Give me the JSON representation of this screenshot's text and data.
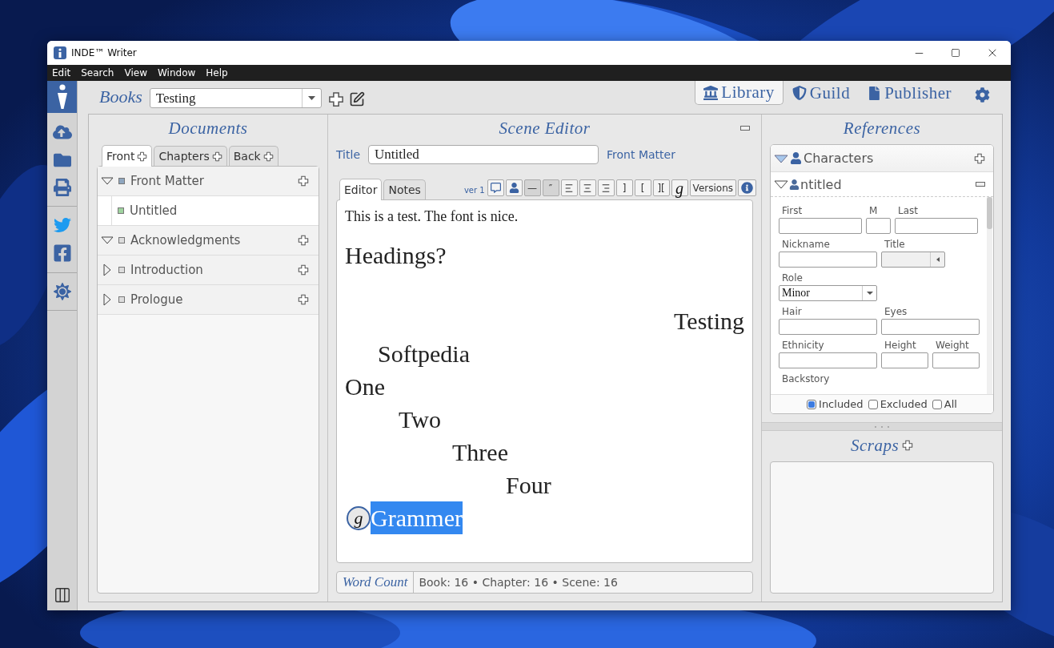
{
  "window": {
    "title": "INDE™ Writer"
  },
  "menu": [
    "Edit",
    "Search",
    "View",
    "Window",
    "Help"
  ],
  "rail": {
    "logo": {
      "selected": true
    },
    "groups": [
      [
        {
          "kind": "cloud"
        },
        {
          "kind": "download"
        },
        {
          "kind": "print"
        }
      ],
      [
        {
          "kind": "twitter"
        },
        {
          "kind": "facebook"
        }
      ],
      [
        {
          "kind": "sun"
        }
      ]
    ],
    "bottom": {
      "kind": "columns"
    }
  },
  "books": {
    "label": "Books",
    "value": "Testing"
  },
  "top_nav": [
    {
      "label": "Library",
      "kind": "library",
      "selected": true
    },
    {
      "label": "Guild",
      "kind": "guild",
      "selected": false
    },
    {
      "label": "Publisher",
      "kind": "publisher",
      "selected": false
    }
  ],
  "documents": {
    "title": "Documents",
    "tabs": [
      {
        "label": "Front",
        "selected": true
      },
      {
        "label": "Chapters",
        "selected": false
      },
      {
        "label": "Back",
        "selected": false
      }
    ],
    "tree": [
      {
        "label": "Front Matter",
        "expanded": true,
        "selected": false,
        "color": "#8fa6bf",
        "children": [
          {
            "label": "Untitled",
            "selected": true,
            "color": "#9fd39f"
          }
        ]
      },
      {
        "label": "Acknowledgments",
        "expanded": true,
        "selected": false,
        "color": "#dcdcdc"
      },
      {
        "label": "Introduction",
        "expanded": false,
        "selected": false,
        "color": "#dcdcdc"
      },
      {
        "label": "Prologue",
        "expanded": false,
        "selected": false,
        "color": "#dcdcdc"
      }
    ]
  },
  "scene_editor": {
    "title": "Scene Editor",
    "title_label": "Title",
    "title_value": "Untitled",
    "section": "Front Matter",
    "tabs": [
      {
        "label": "Editor",
        "selected": true
      },
      {
        "label": "Notes",
        "selected": false
      }
    ],
    "version": "ver 1",
    "toolbar": [
      {
        "kind": "comment",
        "pressed": false
      },
      {
        "kind": "person",
        "pressed": false
      },
      {
        "kind": "text",
        "label": "—",
        "pressed": true
      },
      {
        "kind": "text",
        "label": "″",
        "pressed": true
      },
      {
        "kind": "align-left",
        "pressed": false
      },
      {
        "kind": "align-center",
        "pressed": false
      },
      {
        "kind": "align-right",
        "pressed": false
      },
      {
        "kind": "text",
        "label": "]",
        "pressed": false
      },
      {
        "kind": "text",
        "label": "[",
        "pressed": false
      },
      {
        "kind": "text",
        "label": "][",
        "pressed": false
      },
      {
        "kind": "script",
        "label": "g",
        "pressed": false
      },
      {
        "kind": "text",
        "label": "Versions",
        "pressed": false
      },
      {
        "kind": "info",
        "pressed": false
      }
    ],
    "content": [
      {
        "kind": "body",
        "text": "This is a test. The font is nice."
      },
      {
        "kind": "heading",
        "text": "Headings?"
      },
      {
        "kind": "heading",
        "right_aligned": true,
        "gap_before": true,
        "text": "Testing"
      },
      {
        "kind": "heading",
        "indented": true,
        "text": "Softpedia"
      },
      {
        "kind": "heading",
        "text": "One"
      },
      {
        "kind": "heading",
        "text": "\tTwo"
      },
      {
        "kind": "heading",
        "text": "\t\tThree"
      },
      {
        "kind": "heading",
        "text": "\t\t\tFour"
      },
      {
        "kind": "heading",
        "text": "Grammer",
        "selected": true,
        "marker": "g"
      }
    ],
    "word_count": {
      "label": "Word Count",
      "value": "Book: 16 • Chapter: 16 • Scene: 16"
    }
  },
  "references": {
    "title": "References",
    "section": {
      "label": "Characters",
      "expanded": true
    },
    "character": {
      "name": "ntitled",
      "expanded": true
    },
    "form_rows": [
      [
        {
          "label": "First",
          "kind": "name"
        },
        {
          "label": "M",
          "kind": "initial"
        },
        {
          "label": "Last",
          "kind": "name"
        }
      ],
      [
        {
          "label": "Nickname",
          "kind": "text"
        },
        {
          "label": "Title",
          "kind": "spinner"
        }
      ],
      [
        {
          "label": "Role",
          "kind": "select",
          "value": "Minor"
        }
      ],
      [
        {
          "label": "Hair",
          "kind": "text"
        },
        {
          "label": "Eyes",
          "kind": "text"
        }
      ],
      [
        {
          "label": "Ethnicity",
          "kind": "text"
        },
        {
          "label": "Height",
          "kind": "measure"
        },
        {
          "label": "Weight",
          "kind": "measure"
        }
      ],
      [
        {
          "label": "Backstory",
          "kind": "heading"
        }
      ]
    ],
    "filters": [
      {
        "label": "Included",
        "checked": true
      },
      {
        "label": "Excluded",
        "checked": false
      },
      {
        "label": "All",
        "checked": false
      }
    ],
    "scraps": {
      "title": "Scraps"
    }
  }
}
